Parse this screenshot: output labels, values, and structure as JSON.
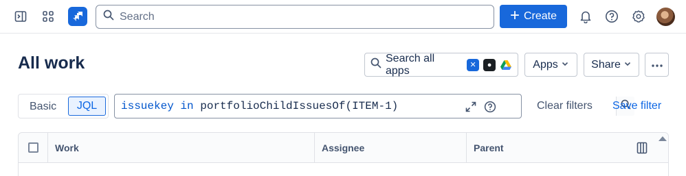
{
  "topbar": {
    "search_placeholder": "Search",
    "create_label": "Create",
    "brand_color": "#1868db",
    "icons": [
      "sidebar-toggle-icon",
      "app-switcher-icon",
      "jira-logo-icon",
      "search-icon",
      "bell-icon",
      "help-icon",
      "settings-icon"
    ]
  },
  "header": {
    "title": "All work",
    "search_all_apps_label": "Search all apps",
    "apps_label": "Apps",
    "share_label": "Share"
  },
  "filter": {
    "basic_label": "Basic",
    "jql_label": "JQL",
    "jql_field": "issuekey",
    "jql_operator": "in",
    "jql_function": "portfolioChildIssuesOf(ITEM-1)",
    "clear_label": "Clear filters",
    "save_label": "Save filter"
  },
  "table": {
    "columns": [
      "Work",
      "Assignee",
      "Parent"
    ]
  }
}
